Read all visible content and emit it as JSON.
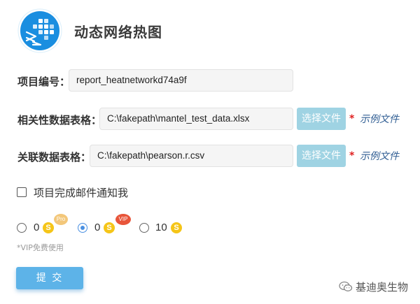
{
  "header": {
    "title": "动态网络热图",
    "logo_icon": "grid-arrows-logo-icon"
  },
  "form": {
    "project_id": {
      "label": "项目编号：",
      "value": "report_heatnetworkd74a9f"
    },
    "correlation_table": {
      "label": "相关性数据表格：",
      "value": "C:\\fakepath\\mantel_test_data.xlsx",
      "button": "选择文件",
      "required_mark": "*",
      "example_link": "示例文件"
    },
    "association_table": {
      "label": "关联数据表格：",
      "value": "C:\\fakepath\\pearson.r.csv",
      "button": "选择文件",
      "required_mark": "*",
      "example_link": "示例文件"
    },
    "email_notify": {
      "label": "项目完成邮件通知我",
      "checked": false
    }
  },
  "plans": [
    {
      "count": "0",
      "coin": "S",
      "badge": "Pro",
      "selected": false
    },
    {
      "count": "0",
      "coin": "S",
      "badge": "VIP",
      "selected": true
    },
    {
      "count": "10",
      "coin": "S",
      "badge": "",
      "selected": false
    }
  ],
  "plan_note": "*VIP免费使用",
  "submit_label": "提 交",
  "watermark": {
    "icon": "wechat-icon",
    "text": "基迪奥生物"
  },
  "colors": {
    "accent_blue": "#5db3e8",
    "choose_button": "#9fd3e3",
    "link": "#2f5d93",
    "required": "#e02020",
    "coin": "#f5c518",
    "badge_pro": "#f3c77a",
    "badge_vip": "#e8553a"
  }
}
